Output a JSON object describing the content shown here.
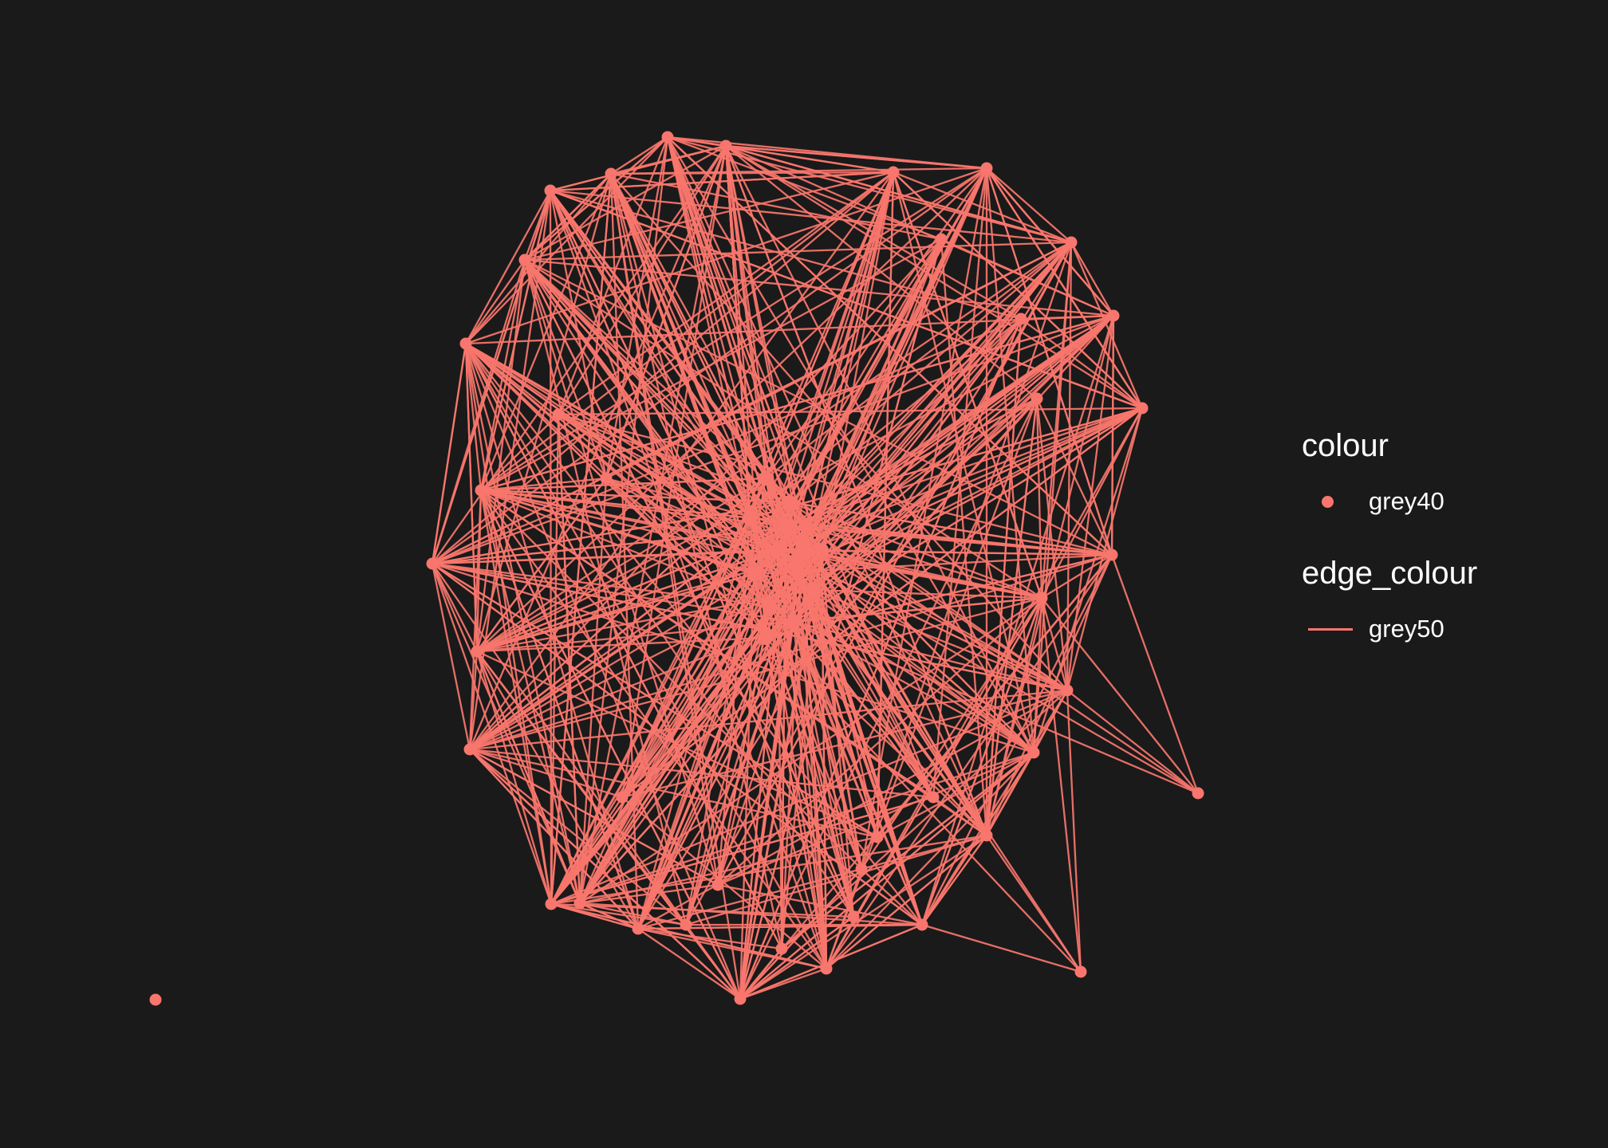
{
  "diagram": {
    "node_color": "#f8766d",
    "edge_color": "#f8766d",
    "background": "#1a1a1a"
  },
  "legend": {
    "colour": {
      "title": "colour",
      "entry": "grey40"
    },
    "edge_colour": {
      "title": "edge_colour",
      "entry": "grey50"
    }
  }
}
